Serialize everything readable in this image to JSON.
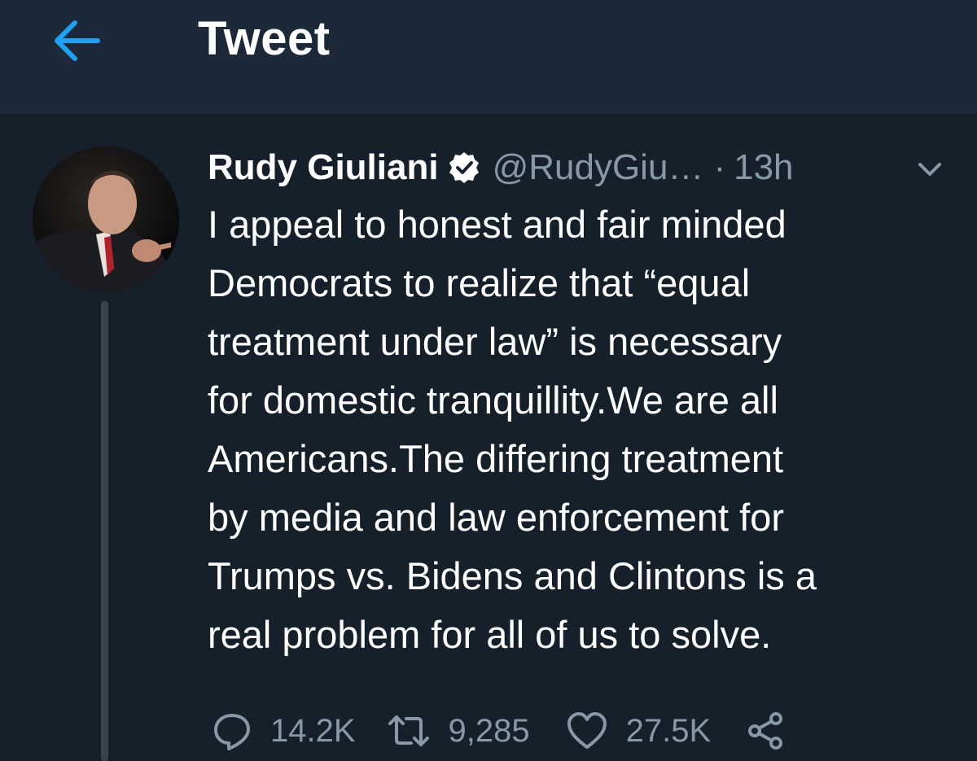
{
  "header": {
    "title": "Tweet",
    "back_icon": "arrow-left-icon"
  },
  "tweet": {
    "author_name": "Rudy Giuliani",
    "verified_icon": "verified-badge-icon",
    "handle": "@RudyGiu…",
    "separator": "·",
    "time": "13h",
    "menu_icon": "chevron-down-icon",
    "text_lines": [
      "I appeal to honest and fair minded",
      "Democrats to realize that “equal",
      "treatment under law” is necessary",
      "for domestic tranquillity.We are all",
      "Americans.The differing treatment",
      "by media and law enforcement for",
      "Trumps vs. Bidens and Clintons is a",
      "real problem for all of us to solve."
    ]
  },
  "actions": {
    "reply": {
      "icon": "reply-icon",
      "count": "14.2K"
    },
    "retweet": {
      "icon": "retweet-icon",
      "count": "9,285"
    },
    "like": {
      "icon": "heart-icon",
      "count": "27.5K"
    },
    "share": {
      "icon": "share-icon"
    }
  },
  "colors": {
    "background": "#15202b",
    "header_background": "#1c2938",
    "accent": "#1da1f2",
    "secondary_text": "#8899a6",
    "primary_text": "#ffffff"
  }
}
